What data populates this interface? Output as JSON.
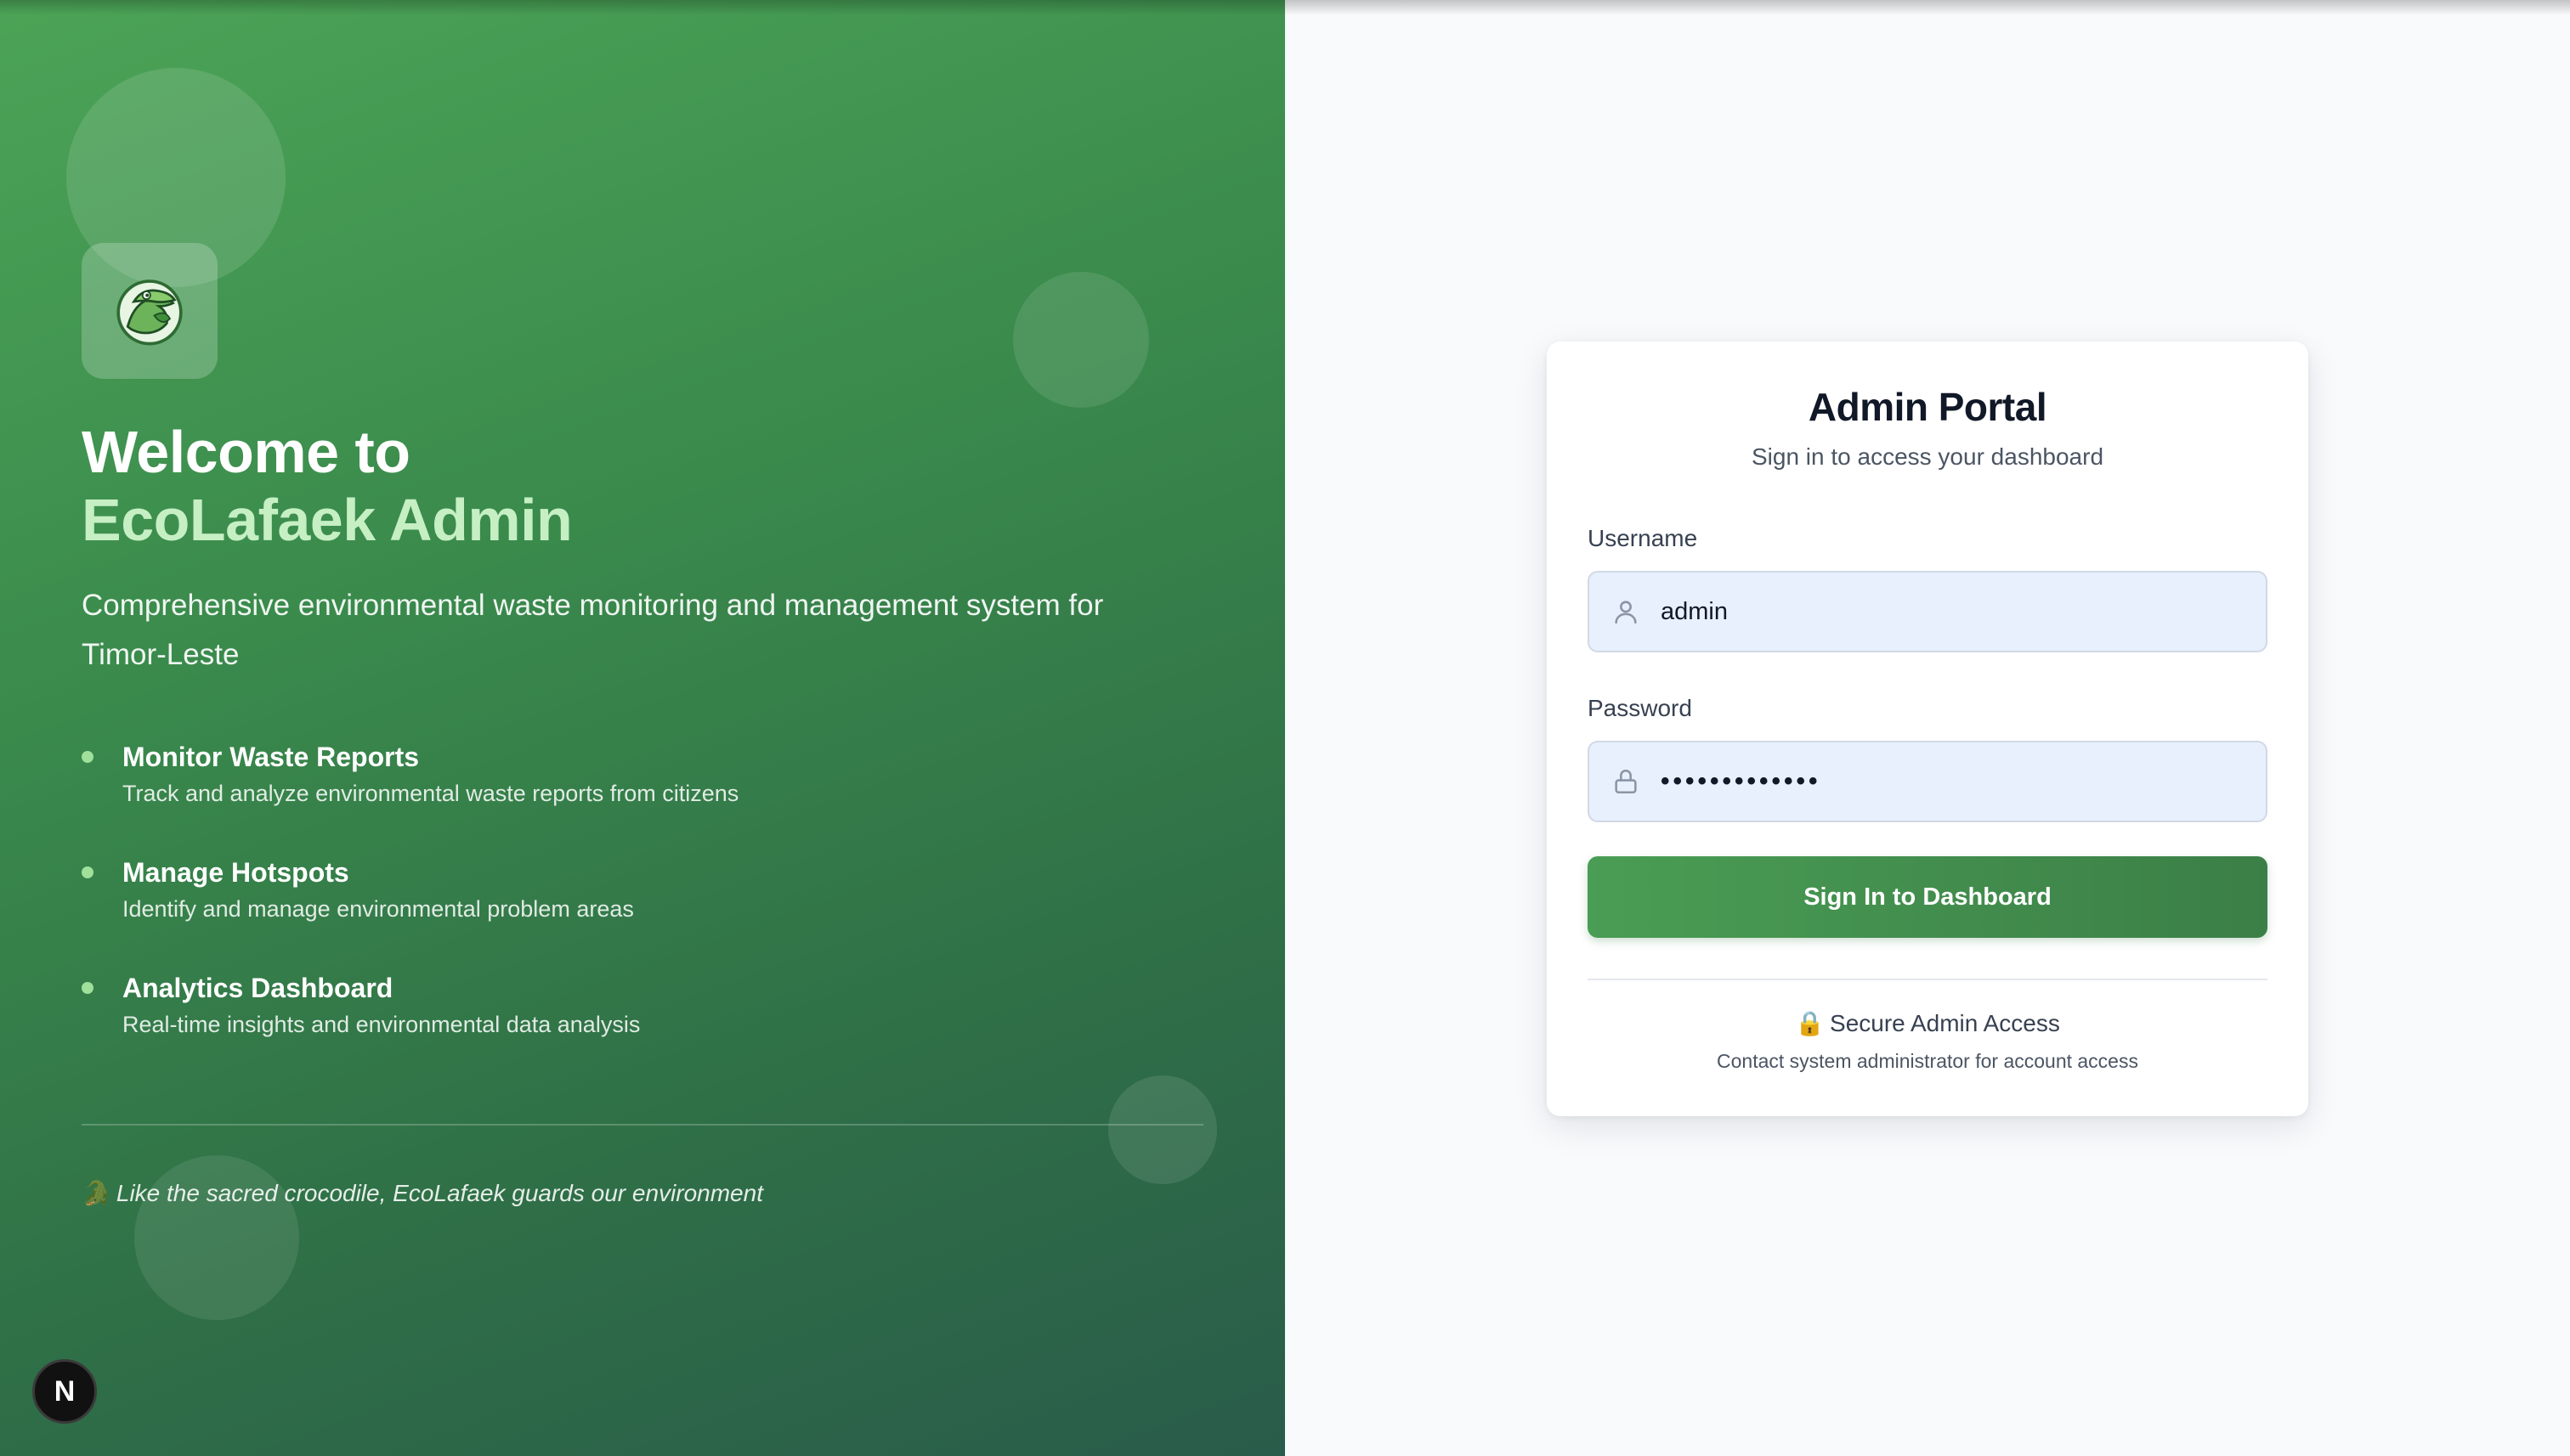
{
  "hero": {
    "title_line1": "Welcome to",
    "title_line2": "EcoLafaek Admin",
    "description": "Comprehensive environmental waste monitoring and management system for Timor-Leste",
    "features": [
      {
        "title": "Monitor Waste Reports",
        "desc": "Track and analyze environmental waste reports from citizens"
      },
      {
        "title": "Manage Hotspots",
        "desc": "Identify and manage environmental problem areas"
      },
      {
        "title": "Analytics Dashboard",
        "desc": "Real-time insights and environmental data analysis"
      }
    ],
    "quote_icon": "🐊",
    "quote": "Like the sacred crocodile, EcoLafaek guards our environment",
    "logo_icon": "crocodile-leaf-logo"
  },
  "dev_badge": {
    "label": "N"
  },
  "login": {
    "title": "Admin Portal",
    "subtitle": "Sign in to access your dashboard",
    "username_label": "Username",
    "username_value": "admin",
    "password_label": "Password",
    "password_value": "•••••••••••••",
    "submit_label": "Sign In to Dashboard",
    "secure_icon": "🔒",
    "secure_title": "Secure Admin Access",
    "secure_note": "Contact system administrator for account access"
  },
  "colors": {
    "brand_green": "#4a9d54",
    "brand_green_dark": "#295c4a",
    "accent_light_green": "#c6efc4",
    "input_bg": "#e8f0fe",
    "page_bg": "#f8fafc"
  }
}
